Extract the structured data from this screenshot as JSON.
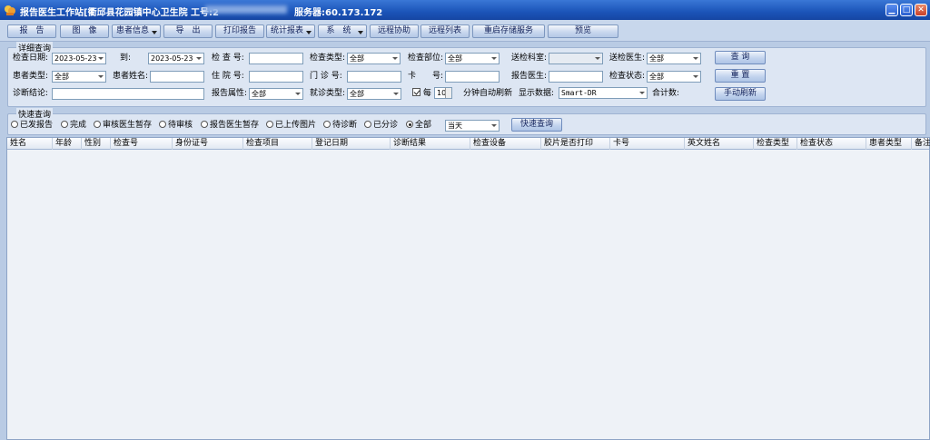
{
  "window": {
    "title": "报告医生工作站[衢邱县花园镇中心卫生院 工号:2",
    "server": "服务器:60.173.172",
    "controls": [
      "▁",
      "□",
      "✕"
    ]
  },
  "toolbar": {
    "items": [
      {
        "label": "报　告",
        "dropdown": false
      },
      {
        "label": "图　像",
        "dropdown": false
      },
      {
        "label": "患者信息",
        "dropdown": true
      },
      {
        "label": "导　出",
        "dropdown": false
      },
      {
        "label": "打印报告",
        "dropdown": false
      },
      {
        "label": "统计报表",
        "dropdown": true
      },
      {
        "label": "系　统",
        "dropdown": true
      },
      {
        "label": "远程协助",
        "dropdown": false
      },
      {
        "label": "远程列表",
        "dropdown": false
      },
      {
        "label": "重启存储服务",
        "dropdown": false
      },
      {
        "label": "预览",
        "dropdown": false
      }
    ]
  },
  "detail": {
    "group_title": "详细查询",
    "row1": {
      "date_label": "检查日期:",
      "date_from": "2023-05-23",
      "to_label": "到:",
      "date_to": "2023-05-23",
      "exam_no_label": "检 查 号:",
      "exam_no": "",
      "exam_type_label": "检查类型:",
      "exam_type": "全部",
      "exam_part_label": "检查部位:",
      "exam_part": "全部",
      "send_dept_label": "送检科室:",
      "send_dept": "",
      "send_doctor_label": "送检医生:",
      "send_doctor": "全部",
      "query_btn": "查 询"
    },
    "row2": {
      "patient_type_label": "患者类型:",
      "patient_type": "全部",
      "patient_name_label": "患者姓名:",
      "patient_name": "",
      "inpatient_no_label": "住 院 号:",
      "inpatient_no": "",
      "outpatient_no_label": "门 诊 号:",
      "outpatient_no": "",
      "card_label": "卡　　号:",
      "card_no": "",
      "report_doctor_label": "报告医生:",
      "report_doctor": "",
      "exam_status_label": "检查状态:",
      "exam_status": "全部",
      "reset_btn": "重 置"
    },
    "row3": {
      "diagnosis_label": "诊断结论:",
      "diagnosis": "",
      "report_attr_label": "报告属性:",
      "report_attr": "全部",
      "visit_type_label": "就诊类型:",
      "visit_type": "全部",
      "auto_refresh_prefix": "每",
      "auto_refresh_minutes": "10",
      "auto_refresh_suffix": "分钟自动刷新",
      "display_label": "显示数据:",
      "display_value": "Smart-DR",
      "total_label": "合计数:",
      "manual_refresh_btn": "手动刷新"
    }
  },
  "quick": {
    "group_title": "快速查询",
    "options": [
      {
        "label": "已发报告",
        "checked": false
      },
      {
        "label": "完成",
        "checked": false
      },
      {
        "label": "审核医生暂存",
        "checked": false
      },
      {
        "label": "待审核",
        "checked": false
      },
      {
        "label": "报告医生暂存",
        "checked": false
      },
      {
        "label": "已上传图片",
        "checked": false
      },
      {
        "label": "待诊断",
        "checked": false
      },
      {
        "label": "已分诊",
        "checked": false
      },
      {
        "label": "全部",
        "checked": true
      }
    ],
    "period": "当天",
    "quick_btn": "快速查询"
  },
  "grid": {
    "columns": [
      "姓名",
      "年龄",
      "性别",
      "检查号",
      "身份证号",
      "检查项目",
      "登记日期",
      "诊断结果",
      "检查设备",
      "胶片是否打印",
      "卡号",
      "英文姓名",
      "检查类型",
      "检查状态",
      "患者类型",
      "备注"
    ]
  },
  "colors": {
    "titlebar": "#1b54b8",
    "window_bg": "#dde6f3",
    "grid_bg": "#eef2f7"
  }
}
